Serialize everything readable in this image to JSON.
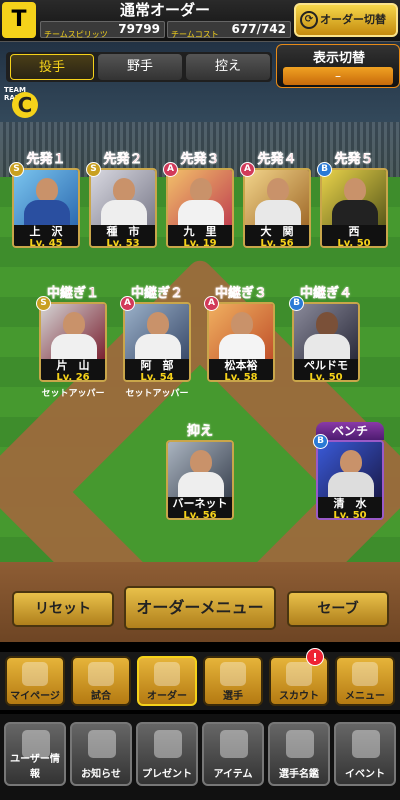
{
  "header": {
    "logo": "T",
    "title": "通常オーダー",
    "spirits_label": "チームスピリッツ",
    "spirits_value": "79799",
    "cost_label": "チームコスト",
    "cost_value": "677/742",
    "order_switch_label": "オーダー切替",
    "order_switch_icon": "cycle-arrows-icon"
  },
  "tabs": [
    {
      "label": "投手",
      "active": true
    },
    {
      "label": "野手"
    },
    {
      "label": "控え"
    }
  ],
  "display_switch": {
    "label": "表示切替",
    "value": "–"
  },
  "team_rank": {
    "label": "TEAM RANK",
    "value": "C"
  },
  "starters": [
    {
      "position": "先発１",
      "rarity": "S",
      "name": "上　沢",
      "level": "Lv. 45"
    },
    {
      "position": "先発２",
      "rarity": "S",
      "name": "種　市",
      "level": "Lv. 53"
    },
    {
      "position": "先発３",
      "rarity": "A",
      "name": "九　里",
      "level": "Lv. 19"
    },
    {
      "position": "先発４",
      "rarity": "A",
      "name": "大　関",
      "level": "Lv. 56"
    },
    {
      "position": "先発５",
      "rarity": "B",
      "name": "西",
      "level": "Lv. 50"
    }
  ],
  "relievers": [
    {
      "position": "中継ぎ１",
      "rarity": "S",
      "name": "片　山",
      "level": "Lv. 26",
      "note": "セットアッパー"
    },
    {
      "position": "中継ぎ２",
      "rarity": "A",
      "name": "阿　部",
      "level": "Lv. 54",
      "note": "セットアッパー"
    },
    {
      "position": "中継ぎ３",
      "rarity": "A",
      "name": "松本裕",
      "level": "Lv. 58"
    },
    {
      "position": "中継ぎ４",
      "rarity": "B",
      "name": "ペルドモ",
      "level": "Lv. 50"
    }
  ],
  "closer": {
    "position": "抑え",
    "name": "バーネット",
    "level": "Lv. 56"
  },
  "bench": {
    "position": "ベンチ",
    "rarity": "B",
    "name": "清　水",
    "level": "Lv. 50"
  },
  "actions": {
    "reset": "リセット",
    "order_menu": "オーダーメニュー",
    "save": "セーブ"
  },
  "nav_main": [
    {
      "label": "マイページ",
      "icon": "mypage-icon"
    },
    {
      "label": "試合",
      "icon": "stadium-icon"
    },
    {
      "label": "オーダー",
      "icon": "clipboard-icon"
    },
    {
      "label": "選手",
      "icon": "player-icon"
    },
    {
      "label": "スカウト",
      "icon": "scout-icon",
      "alert": "!"
    },
    {
      "label": "メニュー",
      "icon": "menu-icon"
    }
  ],
  "nav_sub": [
    {
      "label": "ユーザー情報",
      "icon": "user-info-icon"
    },
    {
      "label": "お知らせ",
      "icon": "notice-icon"
    },
    {
      "label": "プレゼント",
      "icon": "gift-icon"
    },
    {
      "label": "アイテム",
      "icon": "item-icon"
    },
    {
      "label": "選手名鑑",
      "icon": "player-book-icon"
    },
    {
      "label": "イベント",
      "icon": "event-icon"
    }
  ],
  "colors": {
    "rarity_S": "#c9a020",
    "rarity_A": "#d23a5a",
    "rarity_B": "#2a7ad6",
    "accent": "#f5d21a"
  }
}
